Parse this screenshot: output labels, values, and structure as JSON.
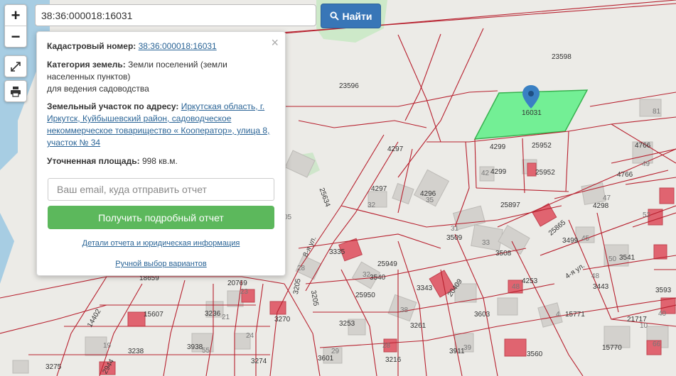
{
  "search": {
    "value": "38:36:000018:16031",
    "button_label": "Найти"
  },
  "controls": {
    "zoom_in": "+",
    "zoom_out": "−"
  },
  "popup": {
    "close": "×",
    "cadastral_label": "Кадастровый номер:",
    "cadastral_value": "38:36:000018:16031",
    "category_label": "Категория земель:",
    "category_value": "Земли поселений (земли населенных пунктов)",
    "category_use": "для ведения садоводства",
    "address_label": "Земельный участок по адресу:",
    "address_value": "Иркутская область, г. Иркутск, Куйбышевский район, садоводческое некоммерческое товарищество « Кооператор», улица 8, участок № 34",
    "area_label": "Уточненная площадь:",
    "area_value": "998 кв.м.",
    "email_placeholder": "Ваш email, куда отправить отчет",
    "get_report_button": "Получить подробный отчет",
    "details_link": "Детали отчета и юридическая информация",
    "manual_link": "Ручной выбор вариантов"
  },
  "map": {
    "selected_parcel": "16031",
    "highlight_color": "#66f08c",
    "boundary_color": "#b7202e",
    "parcel_labels": [
      "23598",
      "23596",
      "4299",
      "25952",
      "4299",
      "25952",
      "4766",
      "4766",
      "4297",
      "4297",
      "4296",
      "25897",
      "4298",
      "25865",
      "3509",
      "3508",
      "3499",
      "3541",
      "3335",
      "25949",
      "3540",
      "3343",
      "20409",
      "4253",
      "3443",
      "3593",
      "20769",
      "25950",
      "3205",
      "3205",
      "15771",
      "21717",
      "18659",
      "15607",
      "3236",
      "3270",
      "3253",
      "3601",
      "3603",
      "3261",
      "3238",
      "3938",
      "3274",
      "3216",
      "3911",
      "3560",
      "15770",
      "3275",
      "14402",
      "2944",
      "25634",
      "8-я ул.",
      "4-я ул."
    ],
    "house_numbers": [
      "81",
      "49",
      "47",
      "52",
      "42",
      "32",
      "35",
      "31",
      "33",
      "45",
      "50",
      "48",
      "28",
      "32",
      "38",
      "48",
      "4",
      "23",
      "21",
      "24",
      "29",
      "39",
      "19",
      "28",
      "40",
      "10",
      "66",
      "05",
      "55"
    ]
  }
}
